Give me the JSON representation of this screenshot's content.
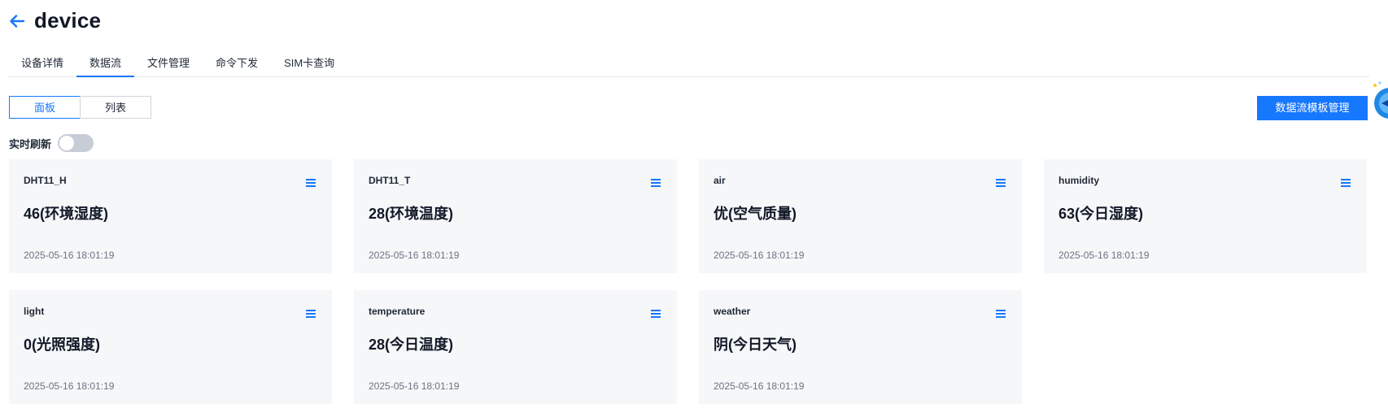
{
  "header": {
    "title": "device"
  },
  "tabs": [
    {
      "label": "设备详情",
      "active": false
    },
    {
      "label": "数据流",
      "active": true
    },
    {
      "label": "文件管理",
      "active": false
    },
    {
      "label": "命令下发",
      "active": false
    },
    {
      "label": "SIM卡查询",
      "active": false
    }
  ],
  "view_switch": {
    "panel": "面板",
    "list": "列表",
    "selected": "面板"
  },
  "toolbar": {
    "template_button": "数据流模板管理"
  },
  "refresh": {
    "label": "实时刷新",
    "enabled": false
  },
  "cards": [
    {
      "name": "DHT11_H",
      "value": "46(环境湿度)",
      "time": "2025-05-16 18:01:19"
    },
    {
      "name": "DHT11_T",
      "value": "28(环境温度)",
      "time": "2025-05-16 18:01:19"
    },
    {
      "name": "air",
      "value": "优(空气质量)",
      "time": "2025-05-16 18:01:19"
    },
    {
      "name": "humidity",
      "value": "63(今日湿度)",
      "time": "2025-05-16 18:01:19"
    },
    {
      "name": "light",
      "value": "0(光照强度)",
      "time": "2025-05-16 18:01:19"
    },
    {
      "name": "temperature",
      "value": "28(今日温度)",
      "time": "2025-05-16 18:01:19"
    },
    {
      "name": "weather",
      "value": "阴(今日天气)",
      "time": "2025-05-16 18:01:19"
    }
  ],
  "icons": {
    "back": "arrow-left-icon",
    "card_menu": "menu-icon",
    "assistant": "assistant-icon"
  },
  "colors": {
    "accent": "#1677ff",
    "card_background": "#f6f7f9",
    "toggle_off": "#c7ccd6"
  }
}
